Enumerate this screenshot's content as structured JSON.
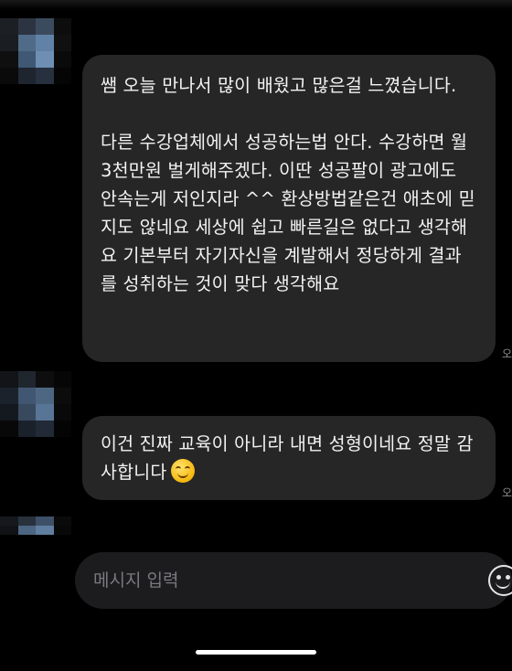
{
  "conversation": {
    "messages": [
      {
        "paragraphs": [
          "쌤 오늘 만나서 많이 배웠고 많은걸 느꼈습니다.",
          "다른 수강업체에서 성공하는법 안다. 수강하면 월 3천만원 벌게해주겠다. 이딴 성공팔이 광고에도 안속는게 저인지라 ^^ 환상방법같은건 애초에 믿지도 않네요 세상에 쉽고 빠른길은 없다고 생각해요 기본부터 자기자신을 계발해서 정당하게 결과를 성취하는 것이 맞다 생각해요"
        ],
        "time": "오"
      },
      {
        "text": "이건 진짜 교육이 아니라 내면 성형이네요 정말 감사합니다",
        "emoji": "smiling-face-emoji",
        "time": "오"
      }
    ]
  },
  "composer": {
    "placeholder": "메시지 입력",
    "sticker_icon": "sticker-smile-icon"
  },
  "colors": {
    "background": "#000000",
    "bubble": "#262626",
    "input": "#1c1c1e"
  }
}
